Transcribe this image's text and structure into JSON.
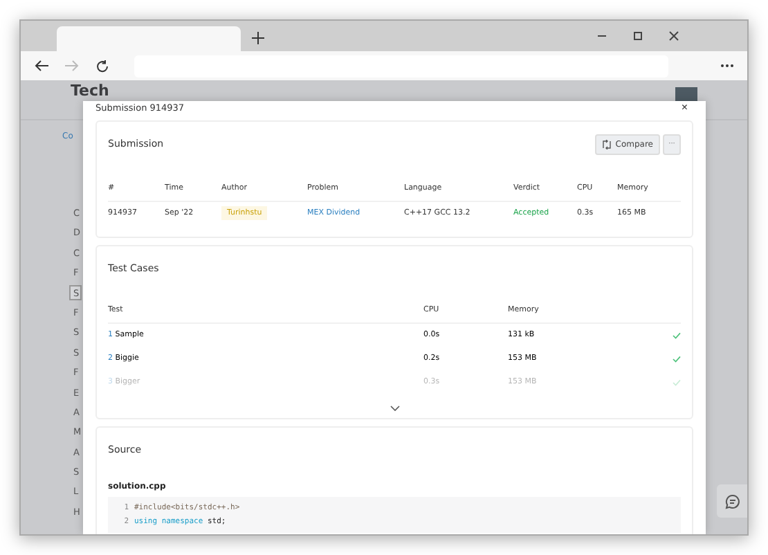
{
  "background": {
    "logo": "Tech",
    "breadcrumb": "Co",
    "sidebar": [
      {
        "label": "C",
        "selected": false
      },
      {
        "label": "D",
        "selected": false
      },
      {
        "label": "C",
        "selected": false
      },
      {
        "label": "F",
        "selected": false
      },
      {
        "label": "S",
        "selected": true
      },
      {
        "label": "F",
        "selected": false
      },
      {
        "label": "S",
        "selected": false
      },
      {
        "label": "S",
        "selected": false
      },
      {
        "label": "F",
        "selected": false
      },
      {
        "label": "E",
        "selected": false
      },
      {
        "label": "A",
        "selected": false
      },
      {
        "label": "M",
        "selected": false
      },
      {
        "label": "A",
        "selected": false
      },
      {
        "label": "S",
        "selected": false
      },
      {
        "label": "L",
        "selected": false
      },
      {
        "label": "H",
        "selected": false
      }
    ]
  },
  "modal": {
    "title": "Submission 914937",
    "close": "×"
  },
  "submission": {
    "title": "Submission",
    "compare": "Compare",
    "more": "···",
    "columns": [
      "#",
      "Time",
      "Author",
      "Problem",
      "Language",
      "Verdict",
      "CPU",
      "Memory"
    ],
    "row": [
      {
        "text": "914937",
        "kind": "plain"
      },
      {
        "text": "Sep '22",
        "kind": "plain"
      },
      {
        "text": "Turinhstu",
        "kind": "author"
      },
      {
        "text": "MEX Dividend",
        "kind": "link"
      },
      {
        "text": "C++17 GCC 13.2",
        "kind": "plain"
      },
      {
        "text": "Accepted",
        "kind": "verdict"
      },
      {
        "text": "0.3s",
        "kind": "plain"
      },
      {
        "text": "165 MB",
        "kind": "plain"
      }
    ]
  },
  "tests": {
    "title": "Test Cases",
    "columns": [
      "Test",
      "CPU",
      "Memory"
    ],
    "rows": [
      {
        "num": "1",
        "name": "Sample",
        "cpu": "0.0s",
        "memory": "131 kB",
        "faded": false
      },
      {
        "num": "2",
        "name": "Biggie",
        "cpu": "0.2s",
        "memory": "153 MB",
        "faded": false
      },
      {
        "num": "3",
        "name": "Bigger",
        "cpu": "0.3s",
        "memory": "153 MB",
        "faded": true
      }
    ]
  },
  "source": {
    "title": "Source",
    "file": "solution.cpp",
    "lines": [
      {
        "num": "1",
        "tokens": [
          {
            "text": "#include<bits/stdc++.h>",
            "kind": "directive"
          }
        ]
      },
      {
        "num": "2",
        "tokens": [
          {
            "text": "using",
            "kind": "keyword"
          },
          {
            "text": "namespace",
            "kind": "keyword"
          },
          {
            "text": "std;",
            "kind": "plain"
          }
        ]
      }
    ]
  }
}
